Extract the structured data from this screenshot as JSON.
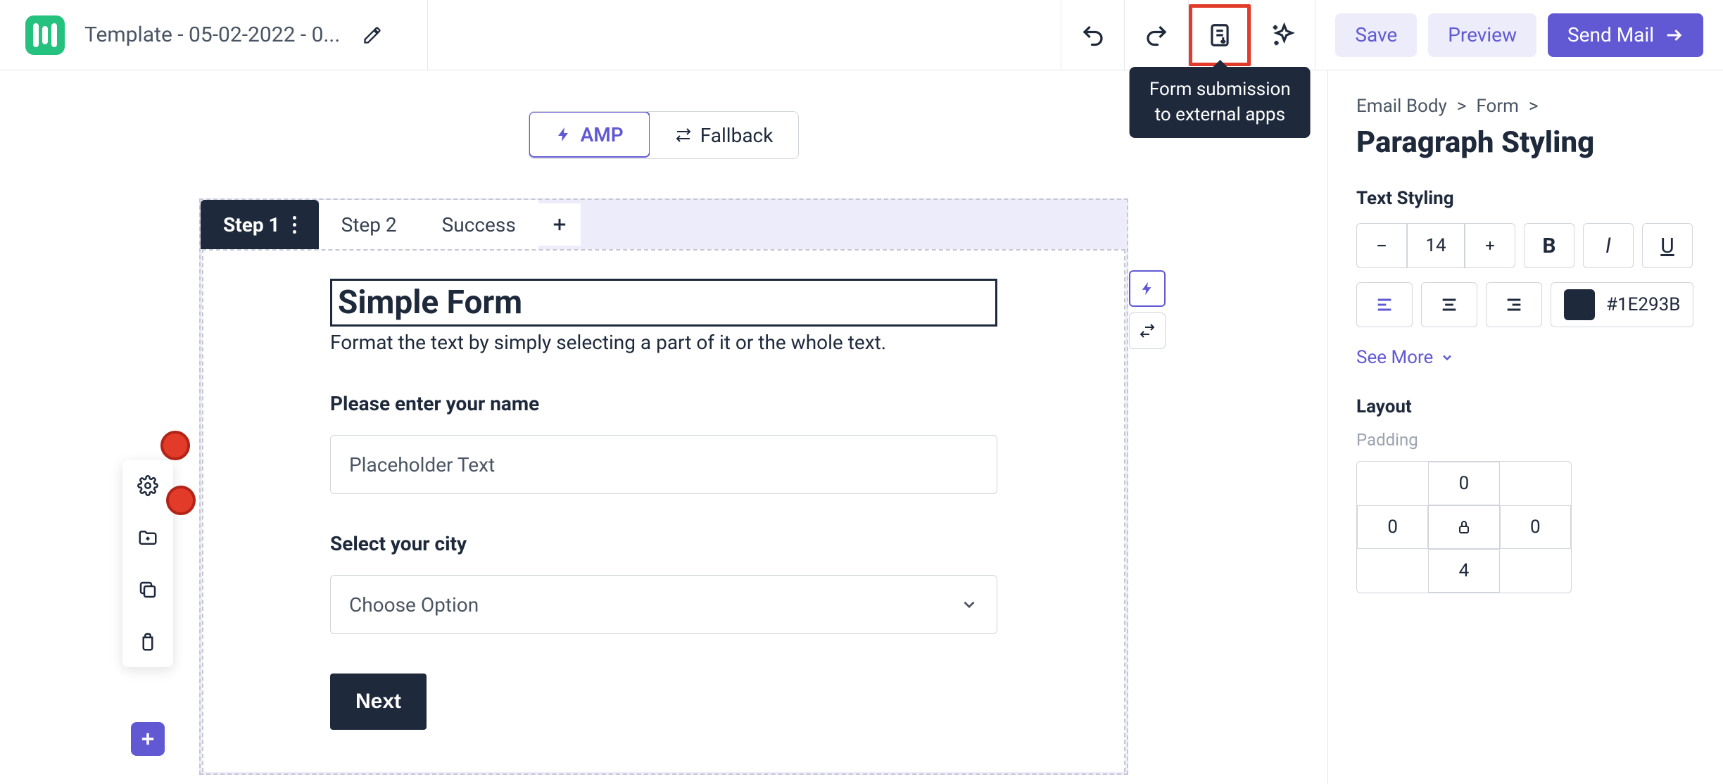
{
  "header": {
    "title": "Template - 05-02-2022 - 0...",
    "tooltip_line1": "Form submission",
    "tooltip_line2": "to external apps",
    "save": "Save",
    "preview": "Preview",
    "send": "Send Mail"
  },
  "toggle": {
    "amp": "AMP",
    "fallback": "Fallback"
  },
  "tabs": {
    "step1": "Step 1",
    "step2": "Step 2",
    "success": "Success"
  },
  "form": {
    "title": "Simple Form",
    "desc": "Format the text by simply selecting a part of it or the whole text.",
    "name_label": "Please enter your name",
    "name_placeholder": "Placeholder Text",
    "city_label": "Select your city",
    "city_placeholder": "Choose Option",
    "next": "Next"
  },
  "panel": {
    "crumb1": "Email Body",
    "crumb2": "Form",
    "title": "Paragraph Styling",
    "text_styling": "Text Styling",
    "font_size": "14",
    "color": "#1E293B",
    "see_more": "See More",
    "layout": "Layout",
    "padding": "Padding",
    "pad_top": "0",
    "pad_left": "0",
    "pad_right": "0",
    "pad_bottom": "4"
  }
}
